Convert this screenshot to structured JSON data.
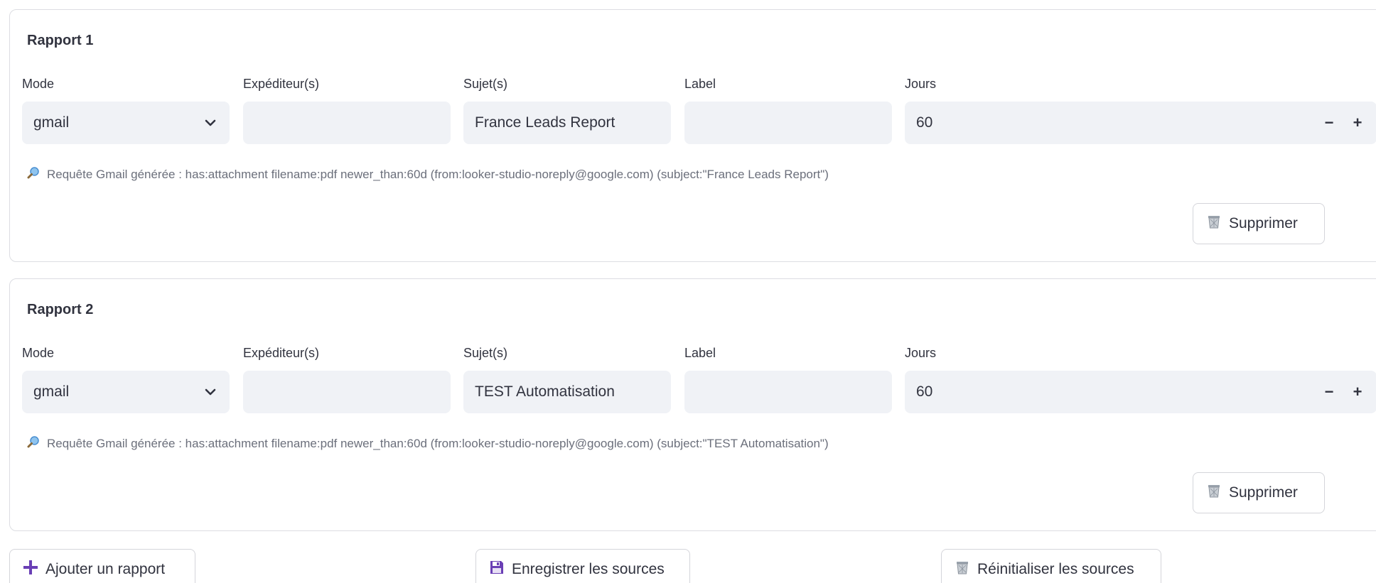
{
  "reports": [
    {
      "title": "Rapport 1",
      "labels": {
        "mode": "Mode",
        "sender": "Expéditeur(s)",
        "subject": "Sujet(s)",
        "label": "Label",
        "days": "Jours"
      },
      "mode_value": "gmail",
      "sender_value": "",
      "subject_value": "France Leads Report",
      "label_value": "",
      "days_value": "60",
      "query_text": "Requête Gmail générée : has:attachment filename:pdf newer_than:60d (from:looker-studio-noreply@google.com) (subject:\"France Leads Report\")",
      "delete_label": "Supprimer"
    },
    {
      "title": "Rapport 2",
      "labels": {
        "mode": "Mode",
        "sender": "Expéditeur(s)",
        "subject": "Sujet(s)",
        "label": "Label",
        "days": "Jours"
      },
      "mode_value": "gmail",
      "sender_value": "",
      "subject_value": "TEST Automatisation",
      "label_value": "",
      "days_value": "60",
      "query_text": "Requête Gmail générée : has:attachment filename:pdf newer_than:60d (from:looker-studio-noreply@google.com) (subject:\"TEST Automatisation\")",
      "delete_label": "Supprimer"
    }
  ],
  "stepper": {
    "minus": "−",
    "plus": "+"
  },
  "actions": {
    "add_label": "Ajouter un rapport",
    "save_label": "Enregistrer les sources",
    "reset_label": "Réinitialiser les sources"
  },
  "colors": {
    "accent_purple": "#6a3fb5",
    "input_bg": "#f0f2f6",
    "query_text": "#6b6f7b"
  },
  "icons": {
    "query": "magnifier-icon",
    "delete": "wastebasket-icon",
    "add": "plus-icon",
    "save": "floppy-disk-icon",
    "reset": "wastebasket-icon"
  }
}
